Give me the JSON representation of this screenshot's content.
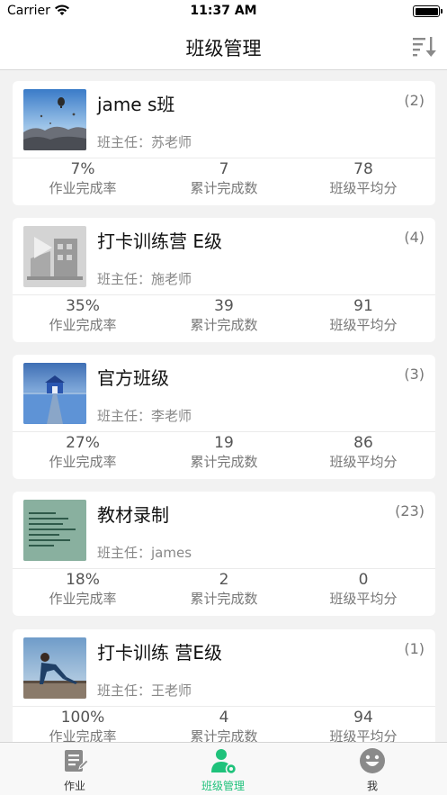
{
  "status_bar": {
    "carrier": "Carrier",
    "time": "11:37 AM"
  },
  "nav": {
    "title": "班级管理",
    "sort_icon": "sort-descending-icon"
  },
  "stat_labels": {
    "completion_rate": "作业完成率",
    "total_completed": "累计完成数",
    "average_score": "班级平均分"
  },
  "classes": [
    {
      "name": "jame s班",
      "count": "(2)",
      "teacher": "班主任：苏老师",
      "completion_rate": "7%",
      "total_completed": "7",
      "average_score": "78",
      "thumb": "balloon-landscape-image"
    },
    {
      "name": "打卡训练营 E级",
      "count": "(4)",
      "teacher": "班主任：施老师",
      "completion_rate": "35%",
      "total_completed": "39",
      "average_score": "91",
      "thumb": "video-placeholder-image"
    },
    {
      "name": "官方班级",
      "count": "(3)",
      "teacher": "班主任：李老师",
      "completion_rate": "27%",
      "total_completed": "19",
      "average_score": "86",
      "thumb": "lake-boathouse-image"
    },
    {
      "name": "教材录制",
      "count": "(23)",
      "teacher": "班主任：james",
      "completion_rate": "18%",
      "total_completed": "2",
      "average_score": "0",
      "thumb": "code-screen-image"
    },
    {
      "name": "打卡训练 营E级",
      "count": "(1)",
      "teacher": "班主任：王老师",
      "completion_rate": "100%",
      "total_completed": "4",
      "average_score": "94",
      "thumb": "workout-photo-image"
    }
  ],
  "tabs": [
    {
      "label": "作业",
      "icon": "homework-icon",
      "active": false
    },
    {
      "label": "班级管理",
      "icon": "class-management-icon",
      "active": true
    },
    {
      "label": "我",
      "icon": "smiley-profile-icon",
      "active": false
    }
  ],
  "colors": {
    "accent": "#1fc27b",
    "background": "#f2f2f2",
    "card": "#ffffff"
  }
}
